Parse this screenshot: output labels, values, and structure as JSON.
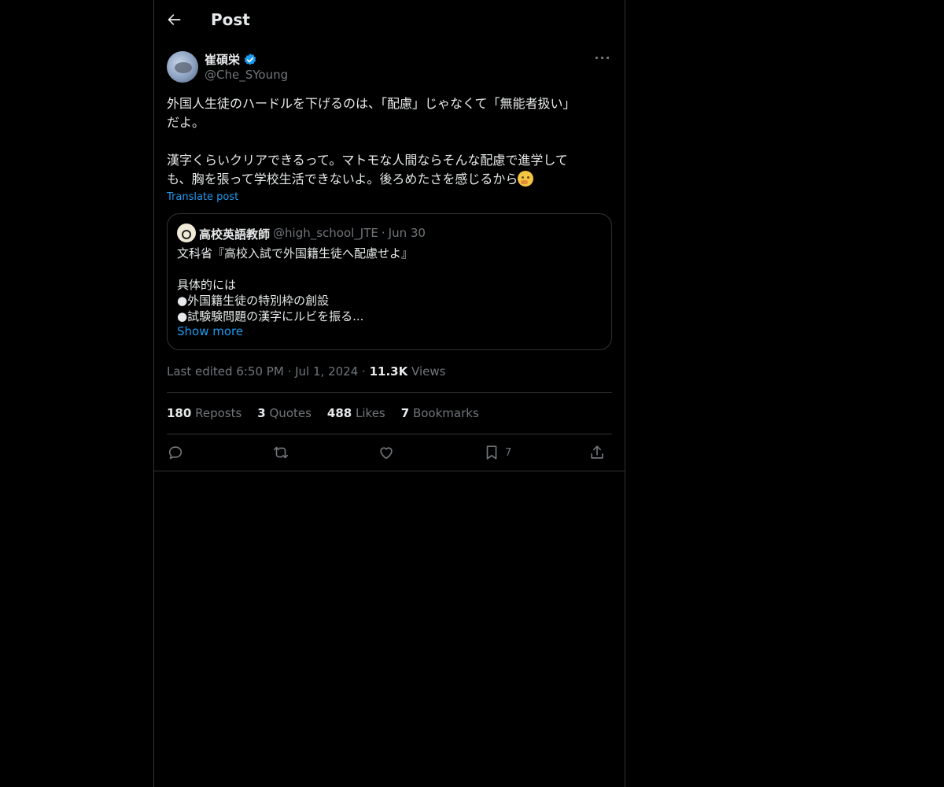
{
  "header": {
    "title": "Post"
  },
  "post": {
    "author_name": "崔碩栄",
    "author_handle": "@Che_SYoung",
    "text": "外国人生徒のハードルを下げるのは、「配慮」じゃなくて「無能者扱い」\nだよ。\n\n漢字くらいクリアできるって。マトモな人間ならそんな配慮で進学して\nも、胸を張って学校生活できないよ。後ろめたさを感じるから",
    "emoji": "thinking-face",
    "translate_label": "Translate post"
  },
  "quote": {
    "author_name": "高校英語教師",
    "author_handle": "@high_school_JTE",
    "separator": "·",
    "date": "Jun 30",
    "text": "文科省『高校入試で外国籍生徒へ配慮せよ』\n\n具体的には\n●外国籍生徒の特別枠の創設\n●試験験問題の漢字にルビを振る...",
    "show_more": "Show more"
  },
  "meta": {
    "edited": "Last edited 6:50 PM",
    "sep1": "·",
    "date": "Jul 1, 2024",
    "sep2": "·",
    "views_count": "11.3K",
    "views_label": "Views"
  },
  "stats": {
    "reposts_count": "180",
    "reposts_label": "Reposts",
    "quotes_count": "3",
    "quotes_label": "Quotes",
    "likes_count": "488",
    "likes_label": "Likes",
    "bookmarks_count": "7",
    "bookmarks_label": "Bookmarks"
  },
  "actions": {
    "bookmark_count": "7"
  },
  "colors": {
    "background": "#000000",
    "text": "#e7e9ea",
    "muted": "#71767b",
    "accent": "#1d9bf0",
    "border": "#2f3336"
  }
}
